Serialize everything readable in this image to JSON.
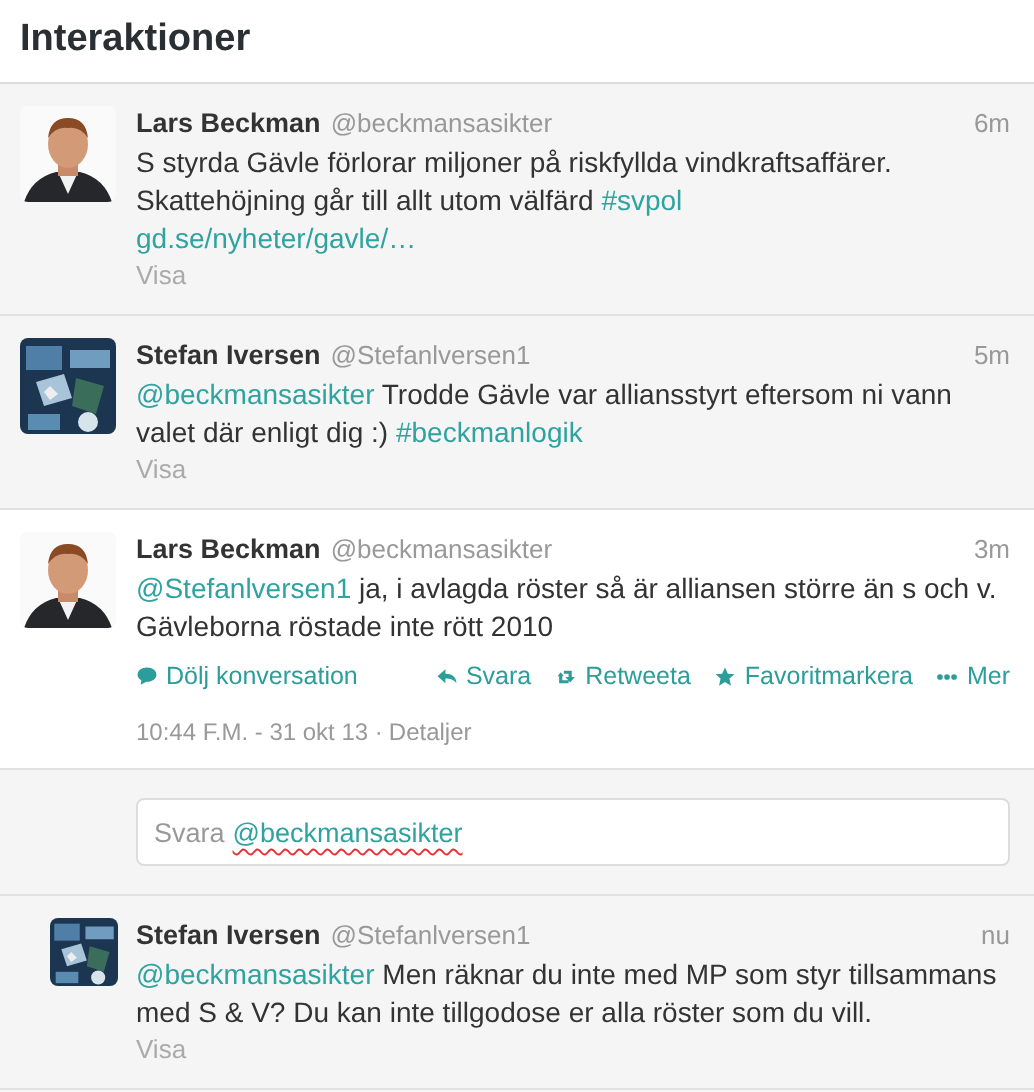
{
  "header": {
    "title": "Interaktioner"
  },
  "tweets": [
    {
      "kind": "collapsed",
      "name": "Lars Beckman",
      "handle": "@beckmansasikter",
      "time": "6m",
      "text": [
        {
          "kind": "text",
          "text": "S styrda Gävle förlorar miljoner på riskfyllda vindkraftsaffärer. Skattehöjning går till allt utom välfärd "
        },
        {
          "kind": "link",
          "text": "#svpol"
        },
        {
          "kind": "break"
        },
        {
          "kind": "link",
          "text": "gd.se/nyheter/gavle/…"
        }
      ],
      "show": "Visa"
    },
    {
      "kind": "collapsed",
      "name": "Stefan Iversen",
      "handle": "@Stefanlversen1",
      "time": "5m",
      "text": [
        {
          "kind": "link",
          "text": "@beckmansasikter"
        },
        {
          "kind": "text",
          "text": " Trodde Gävle var alliansstyrt eftersom ni vann valet där enligt dig :) "
        },
        {
          "kind": "link",
          "text": "#beckmanlogik"
        }
      ],
      "show": "Visa"
    },
    {
      "kind": "expanded",
      "name": "Lars Beckman",
      "handle": "@beckmansasikter",
      "time": "3m",
      "text": [
        {
          "kind": "link",
          "text": "@Stefanlversen1"
        },
        {
          "kind": "text",
          "text": " ja, i avlagda röster så är alliansen större än s och v. Gävleborna röstade inte rött 2010"
        }
      ],
      "actions": [
        {
          "kind": "conversation",
          "label": "Dölj konversation"
        },
        {
          "kind": "reply",
          "label": "Svara"
        },
        {
          "kind": "retweet",
          "label": "Retweeta"
        },
        {
          "kind": "favorite",
          "label": "Favoritmarkera"
        },
        {
          "kind": "more",
          "label": "Mer"
        }
      ],
      "timestamp": "10:44 F.M. - 31 okt 13 ·",
      "details": "Detaljer",
      "reply_box": {
        "prefix": "Svara",
        "mention": "@beckmansasikter"
      }
    },
    {
      "kind": "reply",
      "name": "Stefan Iversen",
      "handle": "@Stefanlversen1",
      "time": "nu",
      "text": [
        {
          "kind": "link",
          "text": "@beckmansasikter"
        },
        {
          "kind": "text",
          "text": " Men räknar du inte med MP som styr tillsammans med S & V? Du kan inte tillgodose er alla röster som du vill."
        }
      ],
      "show": "Visa"
    }
  ]
}
